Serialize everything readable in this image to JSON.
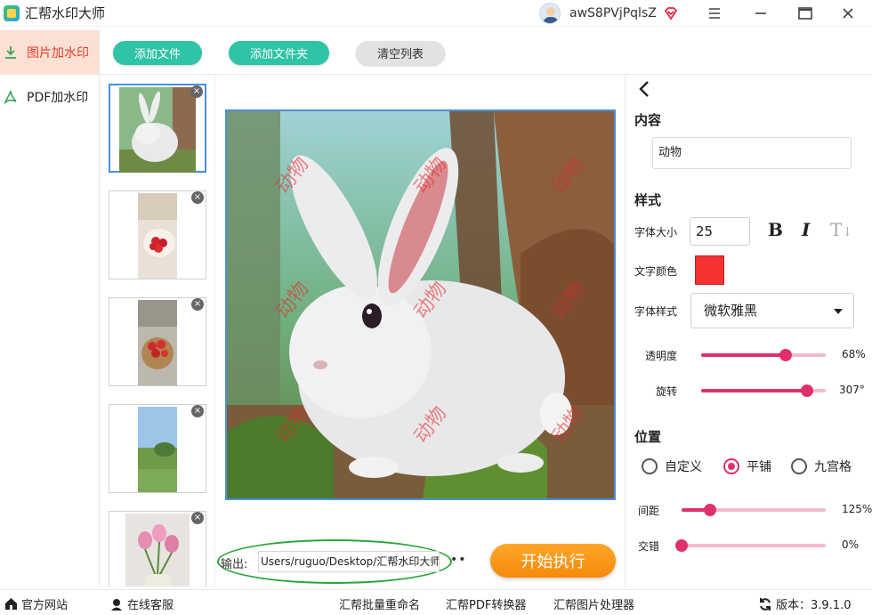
{
  "app": {
    "title": "汇帮水印大师"
  },
  "user": {
    "name": "awS8PVjPqlsZ"
  },
  "nav": {
    "items": [
      {
        "label": "图片加水印"
      },
      {
        "label": "PDF加水印"
      }
    ]
  },
  "toolbar": {
    "add_file": "添加文件",
    "add_folder": "添加文件夹",
    "clear_list": "清空列表"
  },
  "preview": {
    "watermark_text": "动物"
  },
  "output": {
    "label": "输出:",
    "path": "Users/ruguo/Desktop/汇帮水印大师",
    "more": "••"
  },
  "actions": {
    "start": "开始执行"
  },
  "settings": {
    "content_title": "内容",
    "content_value": "动物",
    "style_title": "样式",
    "font_size_label": "字体大小",
    "font_size_value": "25",
    "bold": "B",
    "italic": "I",
    "strike": "T",
    "color_label": "文字颜色",
    "color_value": "#f53131",
    "font_style_label": "字体样式",
    "font_style_value": "微软雅黑",
    "opacity_label": "透明度",
    "opacity_value": "68%",
    "opacity_fraction": 0.68,
    "rotation_label": "旋转",
    "rotation_value": "307°",
    "rotation_fraction": 0.85,
    "position_title": "位置",
    "position_options": [
      {
        "label": "自定义"
      },
      {
        "label": "平铺"
      },
      {
        "label": "九宫格"
      }
    ],
    "spacing_label": "间距",
    "spacing_value": "125%",
    "spacing_fraction": 0.2,
    "stagger_label": "交错",
    "stagger_value": "0%",
    "stagger_fraction": 0.0
  },
  "statusbar": {
    "website": "官方网站",
    "support": "在线客服",
    "rename": "汇帮批量重命名",
    "pdf": "汇帮PDF转换器",
    "image": "汇帮图片处理器",
    "version": "版本：3.9.1.0"
  },
  "colors": {
    "accent_teal": "#2ec4a5",
    "accent_pink": "#e0306a",
    "accent_orange": "#f58a0b",
    "nav_active": "#e23b2e"
  }
}
